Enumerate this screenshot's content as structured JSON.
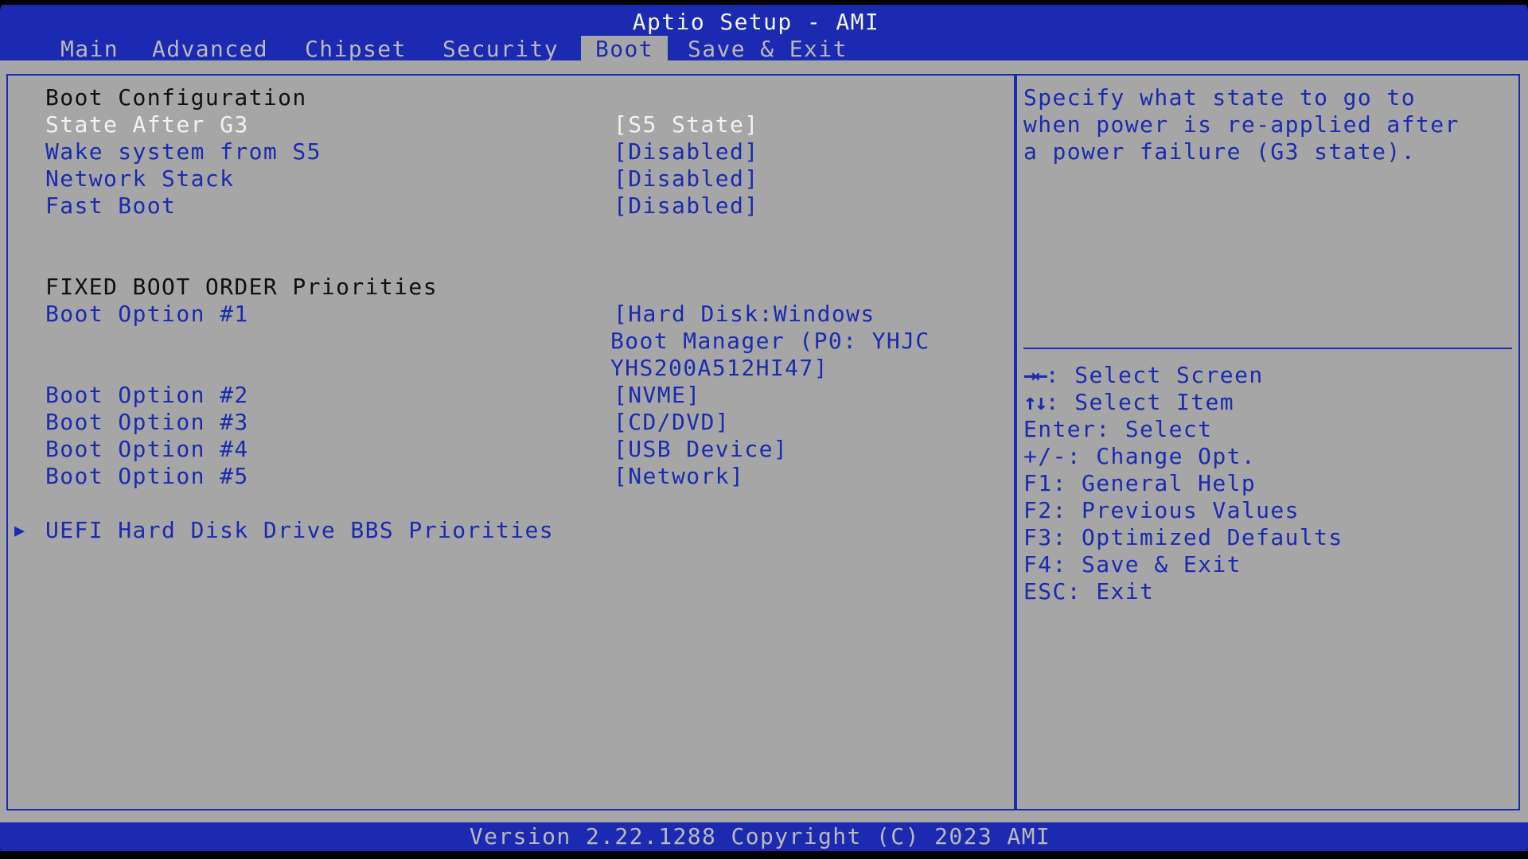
{
  "app_title": "Aptio Setup - AMI",
  "tabs": [
    {
      "label": "Main"
    },
    {
      "label": "Advanced"
    },
    {
      "label": "Chipset"
    },
    {
      "label": "Security"
    },
    {
      "label": "Boot",
      "active": true
    },
    {
      "label": "Save & Exit"
    }
  ],
  "boot_config": {
    "heading": "Boot Configuration",
    "items": [
      {
        "label": "State After G3",
        "value": "[S5 State]",
        "selected": true
      },
      {
        "label": "Wake system from S5",
        "value": "[Disabled]"
      },
      {
        "label": "Network Stack",
        "value": "[Disabled]"
      },
      {
        "label": "Fast Boot",
        "value": "[Disabled]"
      }
    ]
  },
  "boot_order": {
    "heading": "FIXED BOOT ORDER Priorities",
    "options": [
      {
        "label": "Boot Option #1",
        "value_lines": [
          "[Hard Disk:Windows",
          "Boot Manager (P0: YHJC",
          "YHS200A512HI47]"
        ]
      },
      {
        "label": "Boot Option #2",
        "value": "[NVME]"
      },
      {
        "label": "Boot Option #3",
        "value": "[CD/DVD]"
      },
      {
        "label": "Boot Option #4",
        "value": "[USB Device]"
      },
      {
        "label": "Boot Option #5",
        "value": "[Network]"
      }
    ]
  },
  "submenu": {
    "label": "UEFI Hard Disk Drive BBS Priorities",
    "icon": "triangle-right-icon"
  },
  "help": {
    "lines": [
      "Specify what state to go to",
      "when power is re-applied after",
      "a power failure (G3 state)."
    ]
  },
  "keys": [
    {
      "glyph": "→←",
      "text": ": Select Screen"
    },
    {
      "glyph": "↑↓",
      "text": ": Select Item"
    },
    {
      "glyph": "",
      "text": "Enter: Select"
    },
    {
      "glyph": "",
      "text": "+/-: Change Opt."
    },
    {
      "glyph": "",
      "text": "F1: General Help"
    },
    {
      "glyph": "",
      "text": "F2: Previous Values"
    },
    {
      "glyph": "",
      "text": "F3: Optimized Defaults"
    },
    {
      "glyph": "",
      "text": "F4: Save & Exit"
    },
    {
      "glyph": "",
      "text": "ESC: Exit"
    }
  ],
  "version": "Version 2.22.1288 Copyright (C) 2023 AMI",
  "colors": {
    "blue": "#1b2ab0",
    "gray": "#a6a6a6",
    "highlight": "#f2f2f2"
  }
}
